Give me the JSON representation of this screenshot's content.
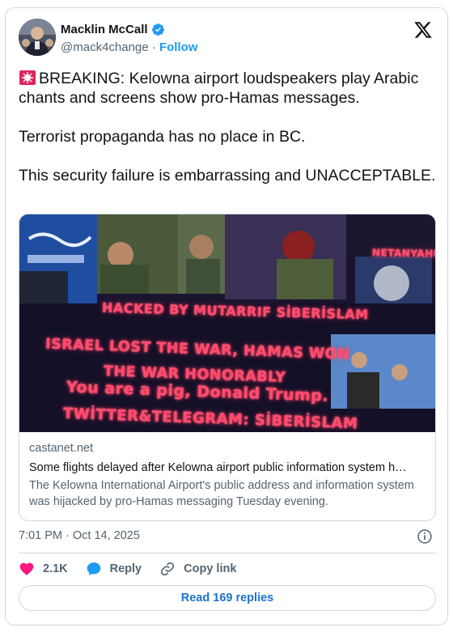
{
  "author": {
    "name": "Macklin McCall",
    "handle": "@mack4change",
    "separator": "·",
    "follow_label": "Follow"
  },
  "tweet": {
    "text": "BREAKING: Kelowna airport loudspeakers play Arabic chants and screens show pro-Hamas messages.\n\nTerrorist propaganda has no place in BC.\n\nThis security failure is embarrassing and UNACCEPTABLE."
  },
  "media": {
    "screen_text": {
      "line1": "HACKED BY MUTARRIF SİBERİSLAM",
      "line2": "ISRAEL LOST THE WAR, HAMAS WON",
      "line3": "THE WAR HONORABLY",
      "line4": "You are a pig, Donald Trump.",
      "line5": "TWİTTER&TELEGRAM: SİBERİSLAM",
      "label": "NETANYAHU"
    }
  },
  "link_card": {
    "domain": "castanet.net",
    "title": "Some flights delayed after Kelowna airport public information system h…",
    "description": "The Kelowna International Airport's public address and information system was hijacked by pro-Hamas messaging Tuesday evening."
  },
  "timestamp": "7:01 PM · Oct 14, 2025",
  "actions": {
    "likes": "2.1K",
    "reply_label": "Reply",
    "copy_label": "Copy link"
  },
  "read_replies_label": "Read 169 replies",
  "colors": {
    "accent": "#1d9bf0",
    "like": "#f91880",
    "muted": "#536471",
    "border": "#cfd9de"
  }
}
